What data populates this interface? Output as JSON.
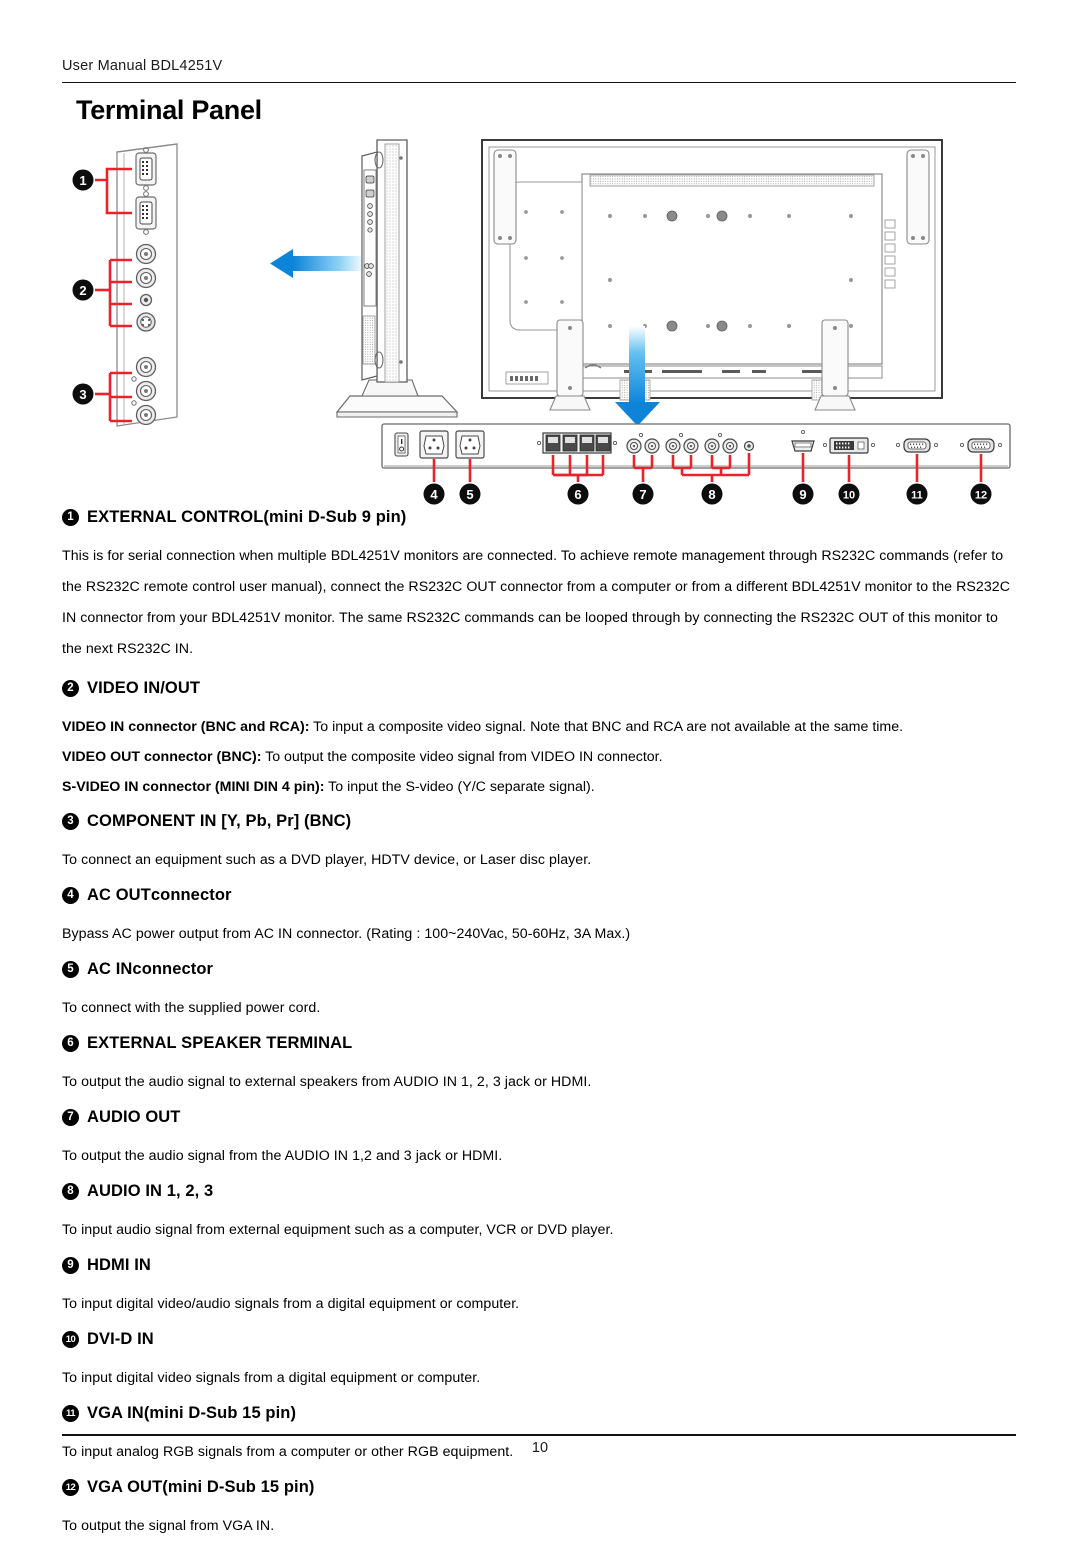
{
  "header": {
    "manual_line": "User Manual BDL4251V",
    "title": "Terminal Panel"
  },
  "footer": {
    "page_number": "10"
  },
  "figure": {
    "caption_numbers": [
      "1",
      "2",
      "3",
      "4",
      "5",
      "6",
      "7",
      "8",
      "9",
      "10",
      "11",
      "12"
    ],
    "arrow_color_dark": "#0d84d8",
    "arrow_color_light": "#bfe4fa",
    "callout_color": "#e8232a",
    "views": {
      "left_panel": "side-terminal-panel-closeup",
      "side_view": "monitor-side-view",
      "rear_view": "monitor-rear-view",
      "bottom_panel": "bottom-terminal-strip"
    }
  },
  "sections": [
    {
      "num": "1",
      "heading_main": "EXTERNAL CONTROL",
      "heading_sub": " (mini D-Sub 9 pin)",
      "body": "This is for serial connection when multiple BDL4251V monitors are connected. To achieve remote management through RS232C commands (refer to the RS232C remote control user manual), connect the RS232C OUT connector from a computer or from a different BDL4251V monitor to the RS232C IN connector from your BDL4251V monitor. The same RS232C commands can be looped through by connecting the RS232C OUT of this monitor to the next RS232C IN."
    },
    {
      "num": "2",
      "heading_main": "VIDEO IN/OUT",
      "heading_sub": "",
      "subitems": [
        {
          "label": "VIDEO IN connector (BNC and RCA):",
          "text": " To input a composite video signal.   Note that BNC and RCA are not available at the same time."
        },
        {
          "label": "VIDEO OUT connector (BNC):",
          "text": " To output the composite video signal from VIDEO IN connector."
        },
        {
          "label": "S-VIDEO IN connector (MINI DIN 4 pin):",
          "text": " To input the S-video (Y/C separate signal)."
        }
      ]
    },
    {
      "num": "3",
      "heading_main": "COMPONENT IN [Y, Pb, Pr] (BNC)",
      "heading_sub": "",
      "body": "To connect an equipment such as a DVD player, HDTV device, or Laser disc player."
    },
    {
      "num": "4",
      "heading_main": "AC OUT",
      "heading_sub": " connector",
      "body": "Bypass AC power output from AC IN connector. (Rating : 100~240Vac, 50-60Hz, 3A Max.)"
    },
    {
      "num": "5",
      "heading_main": "AC IN",
      "heading_sub": " connector",
      "body": "To connect with the supplied power cord."
    },
    {
      "num": "6",
      "heading_main": "EXTERNAL SPEAKER TERMINAL",
      "heading_sub": "",
      "body": "To output the audio signal to external speakers from AUDIO IN 1, 2, 3 jack or HDMI."
    },
    {
      "num": "7",
      "heading_main": "AUDIO OUT",
      "heading_sub": "",
      "body": "To output the audio signal from the AUDIO IN 1,2 and 3 jack or HDMI."
    },
    {
      "num": "8",
      "heading_main": "AUDIO IN 1, 2, 3",
      "heading_sub": "",
      "body": "To input audio signal from external equipment such as a computer, VCR or DVD player."
    },
    {
      "num": "9",
      "heading_main": "HDMI IN",
      "heading_sub": "",
      "body": "To input digital video/audio signals from a digital equipment or computer."
    },
    {
      "num": "10",
      "heading_main": "DVI-D IN",
      "heading_sub": "",
      "body": "To input digital video signals from a digital equipment or computer."
    },
    {
      "num": "11",
      "heading_main": "VGA IN",
      "heading_sub": " (mini D-Sub 15 pin)",
      "body": "To input analog RGB signals from a computer or other RGB equipment."
    },
    {
      "num": "12",
      "heading_main": "VGA OUT",
      "heading_sub": " (mini D-Sub 15 pin)",
      "body": "To output the signal from VGA IN."
    }
  ]
}
